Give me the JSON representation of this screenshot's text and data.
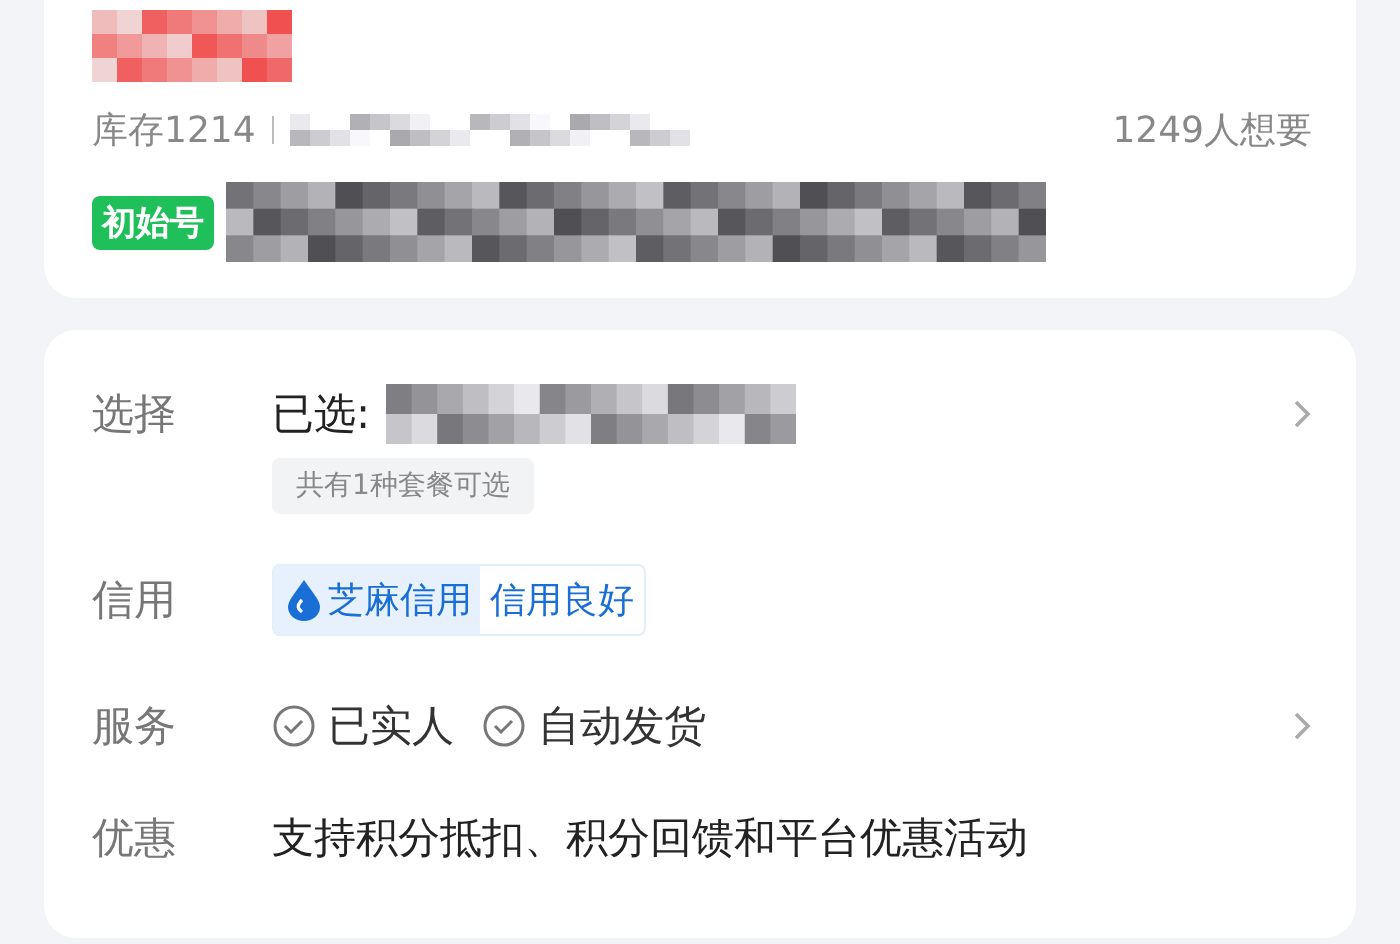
{
  "header": {
    "stock": "库存1214",
    "wants": "1249人想要",
    "tag": "初始号"
  },
  "options": {
    "label": "选择",
    "selected_prefix": "已选:",
    "hint": "共有1种套餐可选"
  },
  "credit": {
    "label": "信用",
    "provider": "芝麻信用",
    "rating": "信用良好"
  },
  "service": {
    "label": "服务",
    "items": [
      "已实人",
      "自动发货"
    ]
  },
  "promo": {
    "label": "优惠",
    "text": "支持积分抵扣、积分回馈和平台优惠活动"
  }
}
